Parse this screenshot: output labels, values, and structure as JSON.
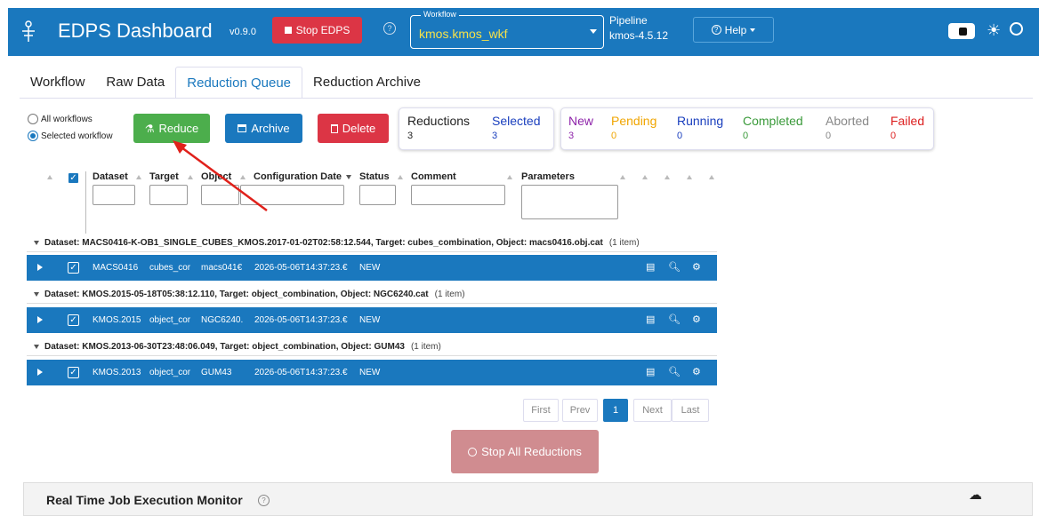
{
  "header": {
    "title": "EDPS Dashboard",
    "version": "v0.9.0",
    "stop_label": "Stop EDPS",
    "help_circle": "?",
    "workflow_legend": "Workflow",
    "workflow_value": "kmos.kmos_wkf",
    "pipeline_label": "Pipeline",
    "pipeline_value": "kmos-4.5.12",
    "help_label": "Help",
    "help_icon": "?",
    "sun_glyph": "☀"
  },
  "tabs": [
    "Workflow",
    "Raw Data",
    "Reduction Queue",
    "Reduction Archive"
  ],
  "filters": {
    "all_workflows": "All workflows",
    "selected_workflow": "Selected workflow"
  },
  "actions": {
    "reduce": "Reduce",
    "archive": "Archive",
    "delete": "Delete"
  },
  "stats_left": {
    "reductions_label": "Reductions",
    "reductions_value": "3",
    "selected_label": "Selected",
    "selected_value": "3"
  },
  "stats_right": {
    "new_label": "New",
    "new_value": "3",
    "pending_label": "Pending",
    "pending_value": "0",
    "running_label": "Running",
    "running_value": "0",
    "completed_label": "Completed",
    "completed_value": "0",
    "aborted_label": "Aborted",
    "aborted_value": "0",
    "failed_label": "Failed",
    "failed_value": "0"
  },
  "columns": {
    "dataset": "Dataset",
    "target": "Target",
    "object": "Object",
    "config_date": "Configuration Date",
    "status": "Status",
    "comment": "Comment",
    "parameters": "Parameters"
  },
  "groups": [
    {
      "header": "Dataset: MACS0416-K-OB1_SINGLE_CUBES_KMOS.2017-01-02T02:58:12.544, Target: cubes_combination, Object: macs0416.obj.cat",
      "count": "(1 item)",
      "row": {
        "dataset": "MACS0416",
        "target": "cubes_cor",
        "object": "macs041€",
        "date": "2026-05-06T14:37:23.€",
        "status": "NEW"
      }
    },
    {
      "header": "Dataset: KMOS.2015-05-18T05:38:12.110, Target: object_combination, Object: NGC6240.cat",
      "count": "(1 item)",
      "row": {
        "dataset": "KMOS.2015",
        "target": "object_cor",
        "object": "NGC6240.",
        "date": "2026-05-06T14:37:23.€",
        "status": "NEW"
      }
    },
    {
      "header": "Dataset: KMOS.2013-06-30T23:48:06.049, Target: object_combination, Object: GUM43",
      "count": "(1 item)",
      "row": {
        "dataset": "KMOS.2013",
        "target": "object_cor",
        "object": "GUM43",
        "date": "2026-05-06T14:37:23.€",
        "status": "NEW"
      }
    }
  ],
  "pager": {
    "first": "First",
    "prev": "Prev",
    "page": "1",
    "next": "Next",
    "last": "Last"
  },
  "stop_all": "Stop All Reductions",
  "monitor": {
    "title": "Real Time Job Execution Monitor",
    "help": "?"
  },
  "colors": {
    "primary": "#1a78be",
    "danger": "#dc3545",
    "success": "#4cae4c",
    "new": "#8e24aa",
    "pending": "#f0a500",
    "running": "#1a3fbe",
    "completed": "#3a9a3a",
    "aborted": "#888888",
    "failed": "#dc1f1f"
  }
}
